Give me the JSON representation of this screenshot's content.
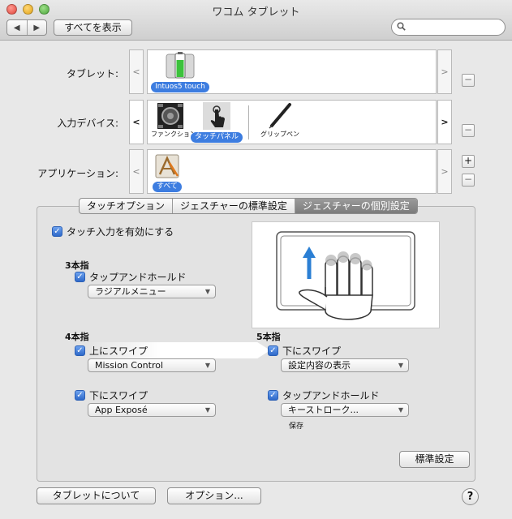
{
  "window": {
    "title": "ワコム タブレット"
  },
  "toolbar": {
    "back": "◀",
    "forward": "▶",
    "show_all": "すべてを表示",
    "search_placeholder": "",
    "search_icon": "magnifier-icon"
  },
  "rows": {
    "tablet": {
      "label": "タブレット:",
      "item_label": "Intuos5 touch",
      "left_arrow": "<",
      "right_arrow": ">",
      "remove": "−"
    },
    "input_device": {
      "label": "入力デバイス:",
      "items": [
        {
          "label": "ファンクション",
          "selected": false
        },
        {
          "label": "タッチパネル",
          "selected": true
        },
        {
          "label": "グリップペン",
          "selected": false
        }
      ],
      "left_arrow": "<",
      "right_arrow": ">",
      "remove": "−"
    },
    "application": {
      "label": "アプリケーション:",
      "item_label": "すべて",
      "left_arrow": "<",
      "right_arrow": ">",
      "add": "+",
      "remove": "−"
    }
  },
  "tabs": [
    {
      "label": "タッチオプション",
      "selected": false
    },
    {
      "label": "ジェスチャーの標準設定",
      "selected": false
    },
    {
      "label": "ジェスチャーの個別設定",
      "selected": true
    }
  ],
  "panel": {
    "enable_touch": {
      "label": "タッチ入力を有効にする",
      "checked": true
    },
    "three_finger": {
      "heading": "3本指",
      "tap_hold": {
        "label": "タップアンドホールド",
        "checked": true,
        "value": "ラジアルメニュー"
      }
    },
    "four_finger": {
      "heading": "4本指",
      "swipe_up": {
        "label": "上にスワイプ",
        "checked": true,
        "value": "Mission Control"
      },
      "swipe_down": {
        "label": "下にスワイプ",
        "checked": true,
        "value": "App Exposé"
      }
    },
    "five_finger": {
      "heading": "5本指",
      "swipe_down": {
        "label": "下にスワイプ",
        "checked": true,
        "value": "設定内容の表示"
      },
      "tap_hold": {
        "label": "タップアンドホールド",
        "checked": true,
        "value": "キーストローク...",
        "note": "保存"
      }
    },
    "defaults_button": "標準設定"
  },
  "footer": {
    "about_button": "タブレットについて",
    "options_button": "オプション...",
    "help": "?"
  },
  "colors": {
    "accent": "#3d7de0",
    "selected_tab": "#8a8a8a",
    "gesture_arrow": "#2b7fd4"
  }
}
